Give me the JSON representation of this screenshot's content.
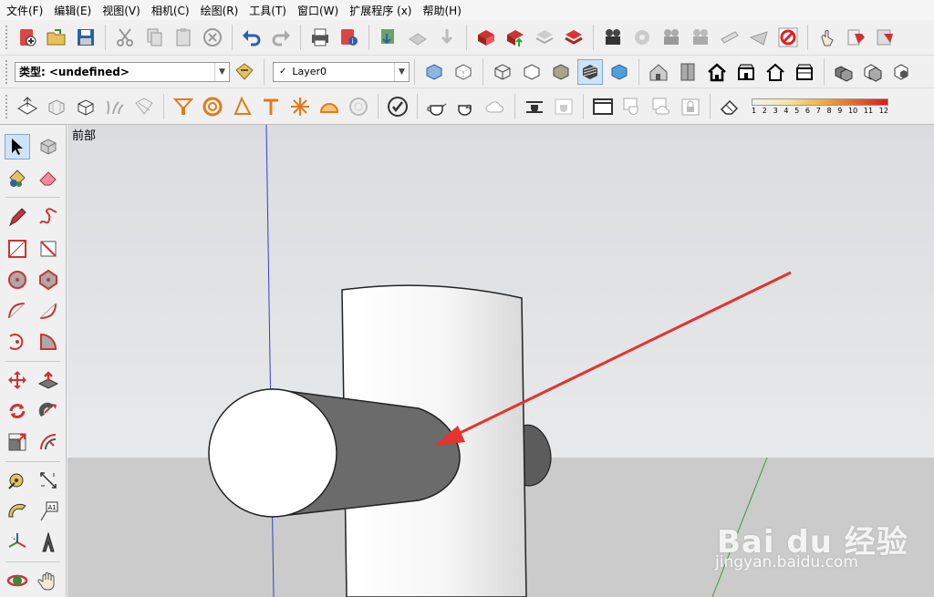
{
  "menu": [
    "文件(F)",
    "编辑(E)",
    "视图(V)",
    "相机(C)",
    "绘图(R)",
    "工具(T)",
    "窗口(W)",
    "扩展程序 (x)",
    "帮助(H)"
  ],
  "entity": {
    "type_label": "类型:",
    "type_value": "<undefined>",
    "layer_check": "✓",
    "layer_value": "Layer0"
  },
  "scale_numbers": [
    "1",
    "2",
    "3",
    "4",
    "5",
    "6",
    "7",
    "8",
    "9",
    "10",
    "11",
    "12"
  ],
  "viewport": {
    "scene_tab": "前部",
    "watermark_logo": "Bai du 经验",
    "watermark_url": "jingyan.baidu.com"
  },
  "colors": {
    "sky": "#e1e3e5",
    "ground": "#cbcbcb",
    "axis_blue": "#3c3cc8",
    "axis_green": "#2ea32e",
    "arrow_red": "#e3342f",
    "shadow_face": "#6b6b6b",
    "selected_tool": "#cfe3f7"
  }
}
